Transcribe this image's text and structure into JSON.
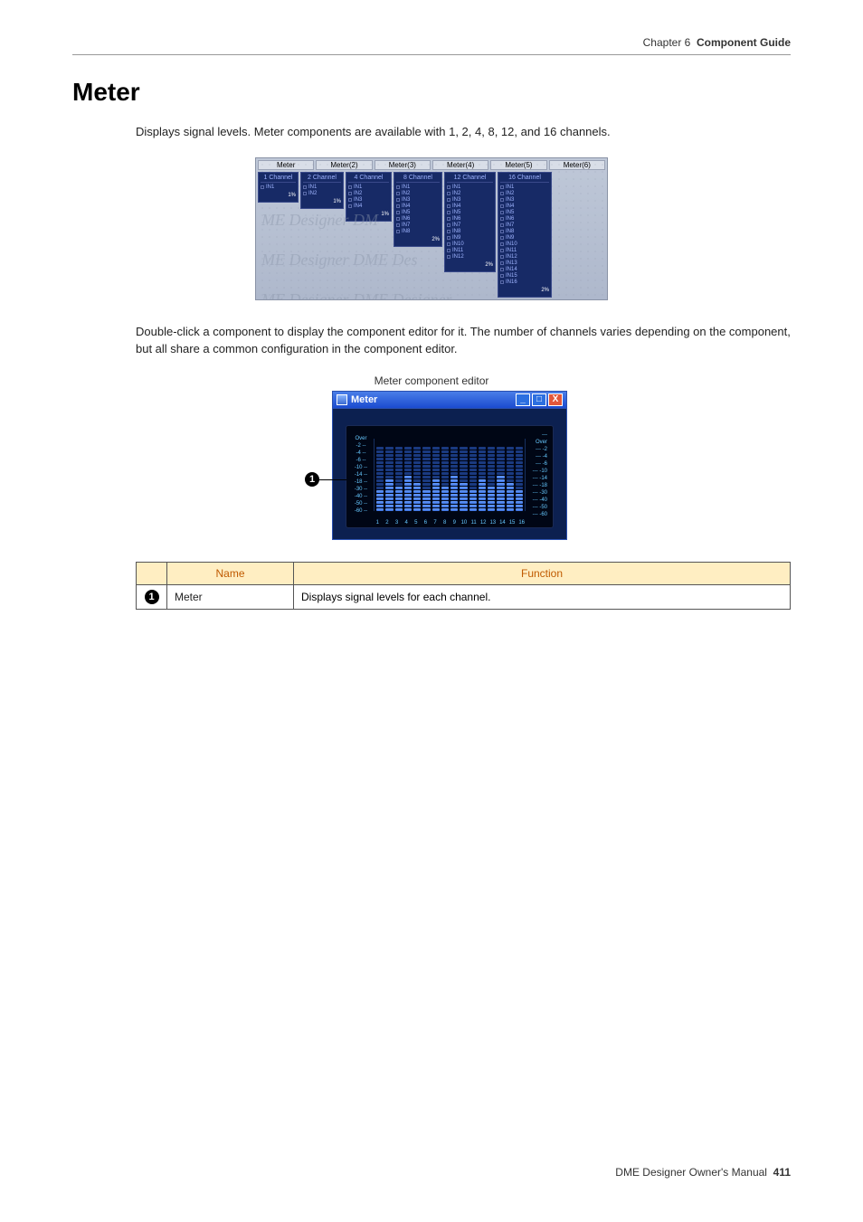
{
  "header": {
    "chapter": "Chapter 6",
    "section": "Component Guide"
  },
  "title": "Meter",
  "intro": "Displays signal levels. Meter components are available with 1, 2, 4, 8, 12, and 16 channels.",
  "designer": {
    "tabs": [
      "Meter",
      "Meter(2)",
      "Meter(3)",
      "Meter(4)",
      "Meter(5)",
      "Meter(6)"
    ],
    "blocks": [
      {
        "title": "1 Channel",
        "ins": [
          "IN1"
        ],
        "zoom": "1%"
      },
      {
        "title": "2 Channel",
        "ins": [
          "IN1",
          "IN2"
        ],
        "zoom": "1%"
      },
      {
        "title": "4 Channel",
        "ins": [
          "IN1",
          "IN2",
          "IN3",
          "IN4"
        ],
        "zoom": "1%"
      },
      {
        "title": "8 Channel",
        "ins": [
          "IN1",
          "IN2",
          "IN3",
          "IN4",
          "IN5",
          "IN6",
          "IN7",
          "IN8"
        ],
        "zoom": "2%"
      },
      {
        "title": "12 Channel",
        "ins": [
          "IN1",
          "IN2",
          "IN3",
          "IN4",
          "IN5",
          "IN6",
          "IN7",
          "IN8",
          "IN9",
          "IN10",
          "IN11",
          "IN12"
        ],
        "zoom": "2%"
      },
      {
        "title": "16 Channel",
        "ins": [
          "IN1",
          "IN2",
          "IN3",
          "IN4",
          "IN5",
          "IN6",
          "IN7",
          "IN8",
          "IN9",
          "IN10",
          "IN11",
          "IN12",
          "IN13",
          "IN14",
          "IN15",
          "IN16"
        ],
        "zoom": "2%"
      }
    ],
    "watermark1": "ME Designer   DM",
    "watermark2": "ME Designer   DME Des",
    "watermark3": "ME Designer   DME Designer"
  },
  "body2": "Double-click a component to display the component editor for it. The number of channels varies depending on the component, but all share a common configuration in the component editor.",
  "editor": {
    "caption": "Meter component editor",
    "title": "Meter",
    "minimize": "_",
    "maximize": "□",
    "close": "X",
    "callout": "1",
    "scaleLeft": [
      "Over",
      "-2 --",
      "-4 --",
      "-6 --",
      "-10 --",
      "-14 --",
      "-18 --",
      "-30 --",
      "-40 --",
      "-50 --",
      "-60 --"
    ],
    "scaleRight": [
      "--- Over",
      "--- -2",
      "--- -4",
      "--- -6",
      "--- -10",
      "--- -14",
      "--- -18",
      "--- -30",
      "--- -40",
      "--- -50",
      "--- -60"
    ],
    "channels": [
      "1",
      "2",
      "3",
      "4",
      "5",
      "6",
      "7",
      "8",
      "9",
      "10",
      "11",
      "12",
      "13",
      "14",
      "15",
      "16"
    ]
  },
  "table": {
    "headName": "Name",
    "headFunc": "Function",
    "rows": [
      {
        "idx": "1",
        "name": "Meter",
        "func": "Displays signal levels for each channel."
      }
    ]
  },
  "footer": {
    "text": "DME Designer Owner's Manual",
    "page": "411"
  }
}
